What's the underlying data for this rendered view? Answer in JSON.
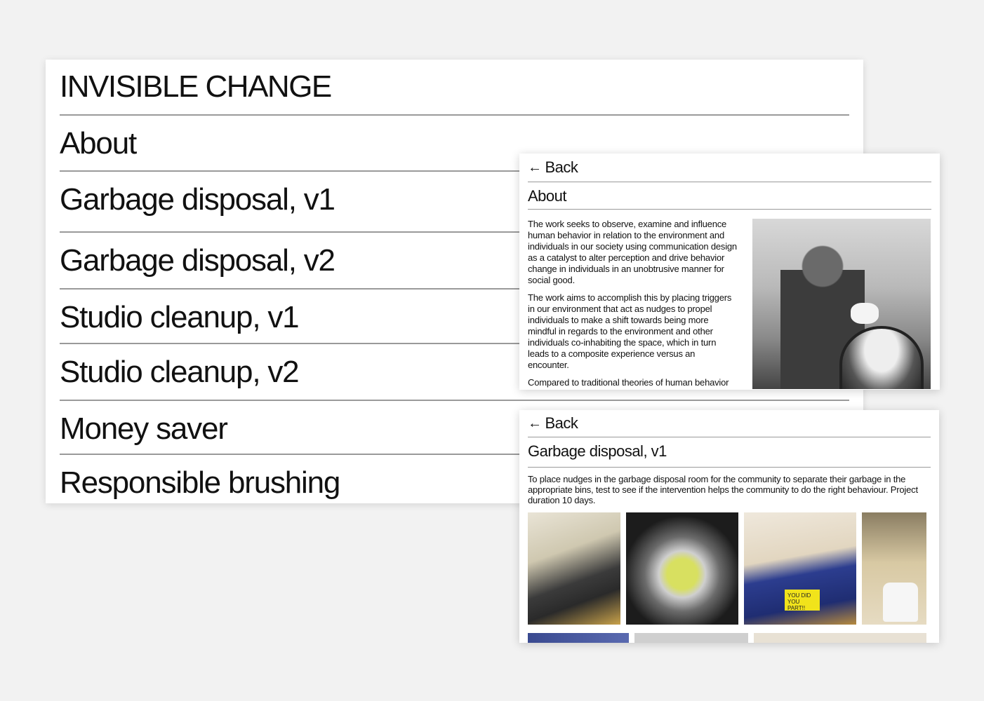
{
  "main": {
    "title": "INVISIBLE CHANGE",
    "nav": [
      "About",
      "Garbage disposal, v1",
      "Garbage disposal, v2",
      "Studio cleanup, v1",
      "Studio cleanup, v2",
      "Money saver",
      "Responsible brushing"
    ]
  },
  "about_panel": {
    "back_label": "Back",
    "heading": "About",
    "paragraphs": [
      "The work seeks to observe, examine and influence human behavior in relation to the environment and individuals in our society using communication design as a catalyst to alter perception and drive behavior change in individuals in an unobtrusive manner for social good.",
      "The work aims to accomplish this by placing triggers in our environment that act as nudges to propel individuals to make a shift towards being more mindful in regards to the environment and other individuals co-inhabiting the space, which in turn leads to a composite experience versus an encounter.",
      "Compared to traditional theories of human behavior design, creating invisible nudges in our"
    ]
  },
  "garbage_panel": {
    "back_label": "Back",
    "heading": "Garbage disposal, v1",
    "description": "To place nudges in the garbage disposal room for the community to separate their garbage in the appropriate bins, test to see if the intervention helps the community to do the right behaviour. Project duration 10 days.",
    "sticker_text": "YOU DID YOU PART!!"
  },
  "icons": {
    "back": "arrow-left-icon"
  }
}
